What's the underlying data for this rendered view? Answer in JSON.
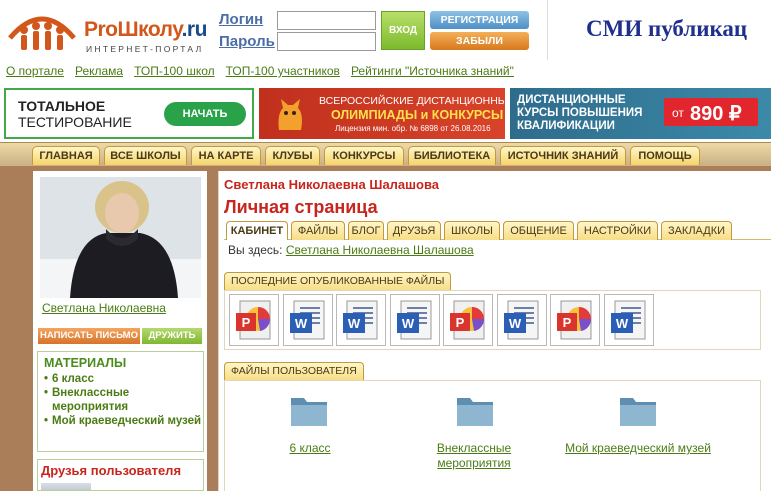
{
  "header": {
    "logo": {
      "brand_a": "Pro",
      "brand_b": "Школу",
      "brand_c": ".ru",
      "subtitle": "ИНТЕРНЕТ-ПОРТАЛ"
    },
    "login_label": "Логин",
    "password_label": "Пароль",
    "login_value": "",
    "password_value": "",
    "login_button": "ВХОД",
    "register_button": "РЕГИСТРАЦИЯ",
    "forgot_button": "ЗАБЫЛИ ПАРОЛЬ?",
    "smi_text": "СМИ публикац"
  },
  "toplinks": [
    "О портале",
    "Реклама",
    "ТОП-100 школ",
    "ТОП-100 участников",
    "Рейтинги \"Источника знаний\""
  ],
  "banners": {
    "b1": {
      "line1": "ТОТАЛЬНОЕ",
      "line2": "ТЕСТИРОВАНИЕ",
      "button": "НАЧАТЬ"
    },
    "b2": {
      "line1": "ВСЕРОССИЙСКИЕ ДИСТАНЦИОННЫЕ",
      "line2": "ОЛИМПИАДЫ и КОНКУРСЫ",
      "line3": "Лицензия мин. обр. № 6898 от 26.08.2016"
    },
    "b3": {
      "line1": "ДИСТАНЦИОННЫЕ",
      "line2": "КУРСЫ ПОВЫШЕНИЯ",
      "line3": "КВАЛИФИКАЦИИ",
      "price_prefix": "от",
      "price": "890 ₽"
    }
  },
  "mainnav": [
    "ГЛАВНАЯ",
    "ВСЕ ШКОЛЫ",
    "НА КАРТЕ",
    "КЛУБЫ",
    "КОНКУРСЫ",
    "БИБЛИОТЕКА",
    "ИСТОЧНИК ЗНАНИЙ",
    "ПОМОЩЬ"
  ],
  "profile": {
    "short_name": "Светлана Николаевна",
    "message_button": "НАПИСАТЬ ПИСЬМО",
    "friend_button": "ДРУЖИТЬ",
    "materials_title": "МАТЕРИАЛЫ",
    "materials": [
      "6 класс",
      "Внеклассные мероприятия",
      "Мой краеведческий музей"
    ],
    "friends_title": "Друзья пользователя"
  },
  "main": {
    "user_title": "Светлана Николаевна Шалашова",
    "page_title": "Личная страница",
    "tabs": [
      "КАБИНЕТ",
      "ФАЙЛЫ",
      "БЛОГ",
      "ДРУЗЬЯ",
      "ШКОЛЫ",
      "ОБЩЕНИЕ",
      "НАСТРОЙКИ",
      "ЗАКЛАДКИ"
    ],
    "breadcrumb_prefix": "Вы здесь:",
    "breadcrumb_link": "Светлана Николаевна Шалашова",
    "recent_files_title": "ПОСЛЕДНИЕ ОПУБЛИКОВАННЫЕ ФАЙЛЫ",
    "recent_files": [
      "ppt-file-icon",
      "doc-file-icon",
      "doc-file-icon",
      "doc-file-icon",
      "ppt-file-icon",
      "doc-file-icon",
      "ppt-file-icon",
      "doc-file-icon"
    ],
    "user_files_title": "ФАЙЛЫ ПОЛЬЗОВАТЕЛЯ",
    "folders": [
      {
        "label": "6 класс"
      },
      {
        "label": "Внеклассные мероприятия"
      },
      {
        "label": "Мой краеведческий музей"
      }
    ]
  },
  "colors": {
    "accent_green": "#4b7c14",
    "title_red": "#c8251d",
    "nav_gold": "#f5d36a",
    "frame_brown": "#a97e58"
  }
}
